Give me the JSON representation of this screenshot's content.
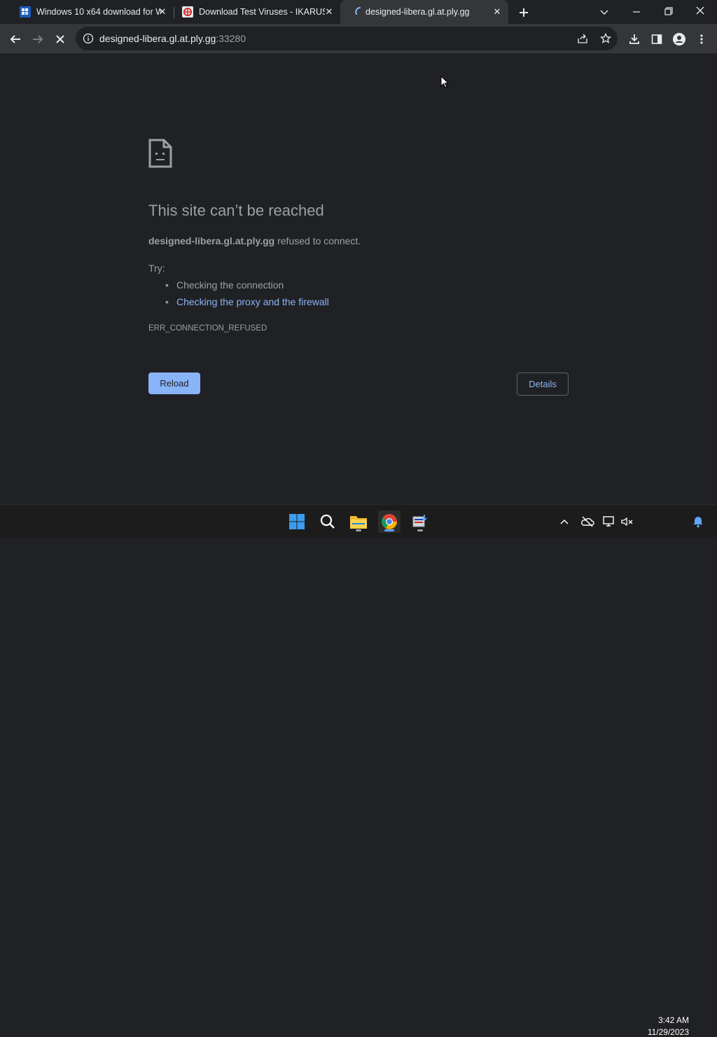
{
  "browser": {
    "tabs": [
      {
        "title": "Windows 10 x64 download for W",
        "favicon": "windows-download-favicon"
      },
      {
        "title": "Download Test Viruses - IKARUS",
        "favicon": "ikarus-favicon"
      },
      {
        "title": "designed-libera.gl.at.ply.gg",
        "favicon": "loading-spinner-icon"
      }
    ],
    "new_tab_icon": "plus-icon",
    "window_controls": [
      "chevron-down-icon",
      "minimize-icon",
      "restore-icon",
      "close-icon"
    ]
  },
  "toolbar": {
    "url_host": "designed-libera.gl.at.ply.gg",
    "url_port": ":33280",
    "icons": [
      "back-arrow-icon",
      "forward-arrow-icon",
      "stop-icon",
      "site-info-icon",
      "share-icon",
      "star-icon",
      "download-icon",
      "side-panel-icon",
      "profile-icon",
      "more-menu-icon"
    ]
  },
  "error_page": {
    "title": "This site can’t be reached",
    "host": "designed-libera.gl.at.ply.gg",
    "message": " refused to connect.",
    "try_label": "Try:",
    "suggestions": [
      {
        "text": "Checking the connection",
        "link": false
      },
      {
        "text": "Checking the proxy and the firewall",
        "link": true
      }
    ],
    "error_code": "ERR_CONNECTION_REFUSED",
    "reload_label": "Reload",
    "details_label": "Details"
  },
  "taskbar": {
    "apps": [
      "windows-start-icon",
      "search-icon",
      "file-explorer-icon",
      "chrome-icon",
      "installer-app-icon"
    ],
    "tray_icons": [
      "chevron-up-icon",
      "onedrive-offline-icon",
      "network-icon",
      "volume-mute-icon",
      "notification-bell-icon"
    ],
    "time": "3:42 AM",
    "date": "11/29/2023"
  },
  "colors": {
    "accent": "#8ab4f8",
    "background": "#202124",
    "toolbar": "#35363a",
    "muted_text": "#9aa0a6"
  }
}
